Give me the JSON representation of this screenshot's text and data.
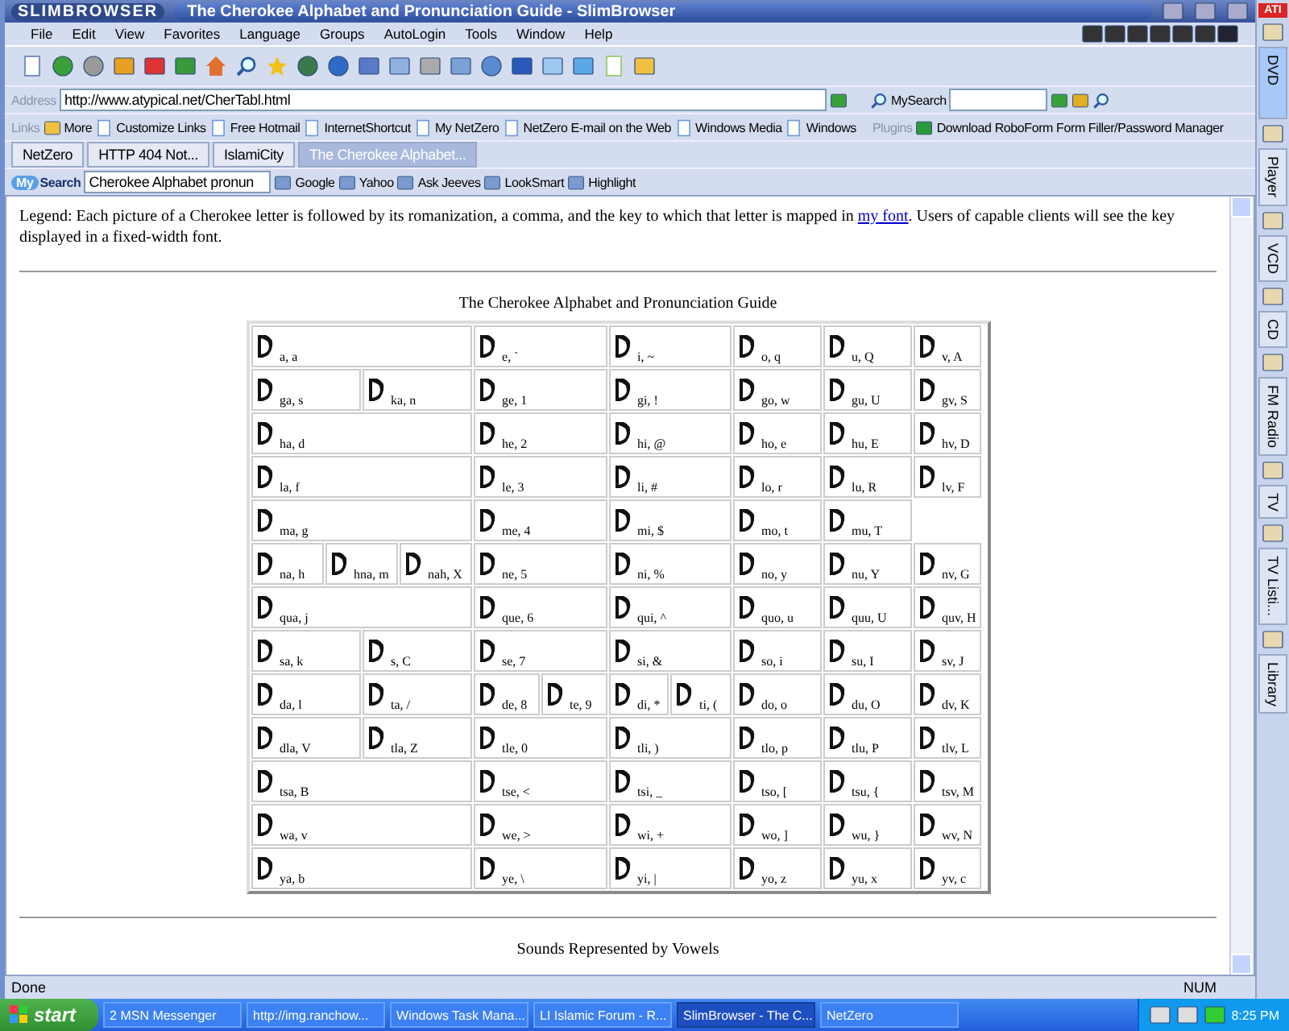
{
  "window": {
    "logo": "SLIMBROWSER",
    "title": "The Cherokee Alphabet and Pronunciation Guide - SlimBrowser"
  },
  "menu": [
    "File",
    "Edit",
    "View",
    "Favorites",
    "Language",
    "Groups",
    "AutoLogin",
    "Tools",
    "Window",
    "Help"
  ],
  "address_bar": {
    "label": "Address",
    "url": "http://www.atypical.net/CherTabl.html",
    "search_label": "MySearch"
  },
  "links_bar": {
    "label": "Links",
    "items": [
      "More",
      "Customize Links",
      "Free Hotmail",
      "InternetShortcut",
      "My NetZero",
      "NetZero E-mail on the Web",
      "Windows Media",
      "Windows"
    ],
    "plugins_label": "Plugins",
    "plugin": "Download RoboForm Form Filler/Password Manager"
  },
  "tabs": [
    {
      "label": "NetZero",
      "selected": false
    },
    {
      "label": "HTTP 404 Not...",
      "selected": false
    },
    {
      "label": "IslamiCity",
      "selected": false
    },
    {
      "label": "The Cherokee Alphabet...",
      "selected": true
    }
  ],
  "search_bar": {
    "logo_badge": "My",
    "logo_text": "Search",
    "query": "Cherokee Alphabet pronun",
    "engines": [
      "Google",
      "Yahoo",
      "Ask Jeeves",
      "LookSmart",
      "Highlight"
    ]
  },
  "page": {
    "legend_before": "Legend: Each picture of a Cherokee letter is followed by its romanization, a comma, and the key to which that letter is mapped in",
    "legend_link": "my font",
    "legend_after": ". Users of capable clients will see the key displayed in a fixed-width font.",
    "table_title": "The Cherokee Alphabet and Pronunciation Guide",
    "rows": [
      [
        [
          "a, a"
        ],
        [
          "e, `"
        ],
        [
          "i, ~"
        ],
        [
          "o, q"
        ],
        [
          "u, Q"
        ],
        [
          "v, A"
        ]
      ],
      [
        [
          "ga, s",
          "ka, n"
        ],
        [
          "ge, 1"
        ],
        [
          "gi, !"
        ],
        [
          "go, w"
        ],
        [
          "gu, U"
        ],
        [
          "gv, S"
        ]
      ],
      [
        [
          "ha, d"
        ],
        [
          "he, 2"
        ],
        [
          "hi, @"
        ],
        [
          "ho, e"
        ],
        [
          "hu, E"
        ],
        [
          "hv, D"
        ]
      ],
      [
        [
          "la, f"
        ],
        [
          "le, 3"
        ],
        [
          "li, #"
        ],
        [
          "lo, r"
        ],
        [
          "lu, R"
        ],
        [
          "lv, F"
        ]
      ],
      [
        [
          "ma, g"
        ],
        [
          "me, 4"
        ],
        [
          "mi, $"
        ],
        [
          "mo, t"
        ],
        [
          "mu, T"
        ],
        []
      ],
      [
        [
          "na, h",
          "hna, m",
          "nah, X"
        ],
        [
          "ne, 5"
        ],
        [
          "ni, %"
        ],
        [
          "no, y"
        ],
        [
          "nu, Y"
        ],
        [
          "nv, G"
        ]
      ],
      [
        [
          "qua, j"
        ],
        [
          "que, 6"
        ],
        [
          "qui, ^"
        ],
        [
          "quo, u"
        ],
        [
          "quu, U"
        ],
        [
          "quv, H"
        ]
      ],
      [
        [
          "sa, k",
          "s, C"
        ],
        [
          "se, 7"
        ],
        [
          "si, &"
        ],
        [
          "so, i"
        ],
        [
          "su, I"
        ],
        [
          "sv, J"
        ]
      ],
      [
        [
          "da, l",
          "ta, /"
        ],
        [
          "de, 8",
          "te, 9"
        ],
        [
          "di, *",
          "ti, ("
        ],
        [
          "do, o"
        ],
        [
          "du, O"
        ],
        [
          "dv, K"
        ]
      ],
      [
        [
          "dla, V",
          "tla, Z"
        ],
        [
          "tle, 0"
        ],
        [
          "tli, )"
        ],
        [
          "tlo, p"
        ],
        [
          "tlu, P"
        ],
        [
          "tlv, L"
        ]
      ],
      [
        [
          "tsa, B"
        ],
        [
          "tse, <"
        ],
        [
          "tsi, _"
        ],
        [
          "tso, ["
        ],
        [
          "tsu, {"
        ],
        [
          "tsv, M"
        ]
      ],
      [
        [
          "wa, v"
        ],
        [
          "we, >"
        ],
        [
          "wi, +"
        ],
        [
          "wo, ]"
        ],
        [
          "wu, }"
        ],
        [
          "wv, N"
        ]
      ],
      [
        [
          "ya, b"
        ],
        [
          "ye, \\"
        ],
        [
          "yi, |"
        ],
        [
          "yo, z"
        ],
        [
          "yu, x"
        ],
        [
          "yv, c"
        ]
      ]
    ],
    "next_heading": "Sounds Represented by Vowels"
  },
  "status_bar": {
    "text": "Done",
    "indicator": "NUM"
  },
  "side_panel": {
    "logo": "ATI",
    "tabs": [
      {
        "label": "DVD",
        "selected": true
      },
      {
        "label": "Player",
        "selected": false
      },
      {
        "label": "VCD",
        "selected": false
      },
      {
        "label": "CD",
        "selected": false
      },
      {
        "label": "FM Radio",
        "selected": false
      },
      {
        "label": "TV",
        "selected": false
      },
      {
        "label": "TV Listi...",
        "selected": false
      },
      {
        "label": "Library",
        "selected": false
      }
    ]
  },
  "taskbar": {
    "start": "start",
    "tasks": [
      {
        "label": "2 MSN Messenger",
        "selected": false
      },
      {
        "label": "http://img.ranchow...",
        "selected": false
      },
      {
        "label": "Windows Task Mana...",
        "selected": false
      },
      {
        "label": "LI Islamic Forum - R...",
        "selected": false
      },
      {
        "label": "SlimBrowser - The C...",
        "selected": true
      },
      {
        "label": "NetZero",
        "selected": false
      }
    ],
    "clock": "8:25 PM"
  }
}
